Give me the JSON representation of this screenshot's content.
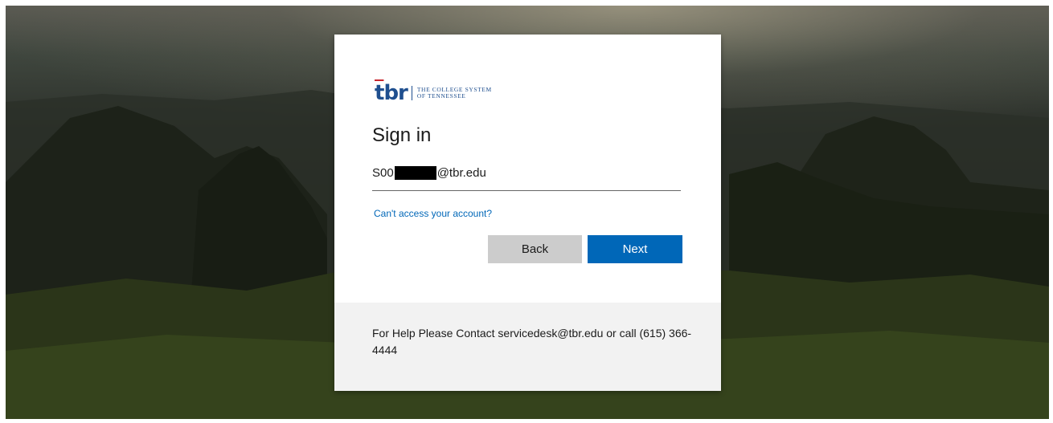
{
  "brand": {
    "logo_mark": "tbr",
    "logo_line1": "THE COLLEGE SYSTEM",
    "logo_line2": "of TENNESSEE"
  },
  "signin": {
    "title": "Sign in",
    "email_prefix": "S00",
    "email_suffix": "@tbr.edu",
    "help_link": "Can't access your account?",
    "back_label": "Back",
    "next_label": "Next"
  },
  "footer": {
    "help_text": "For Help Please Contact servicedesk@tbr.edu or call (615) 366-4444"
  },
  "colors": {
    "primary": "#0067b8",
    "secondary_button": "#cccccc",
    "footer_bg": "#f2f2f2",
    "brand_blue": "#1f4f8f",
    "brand_red": "#c8282e"
  }
}
